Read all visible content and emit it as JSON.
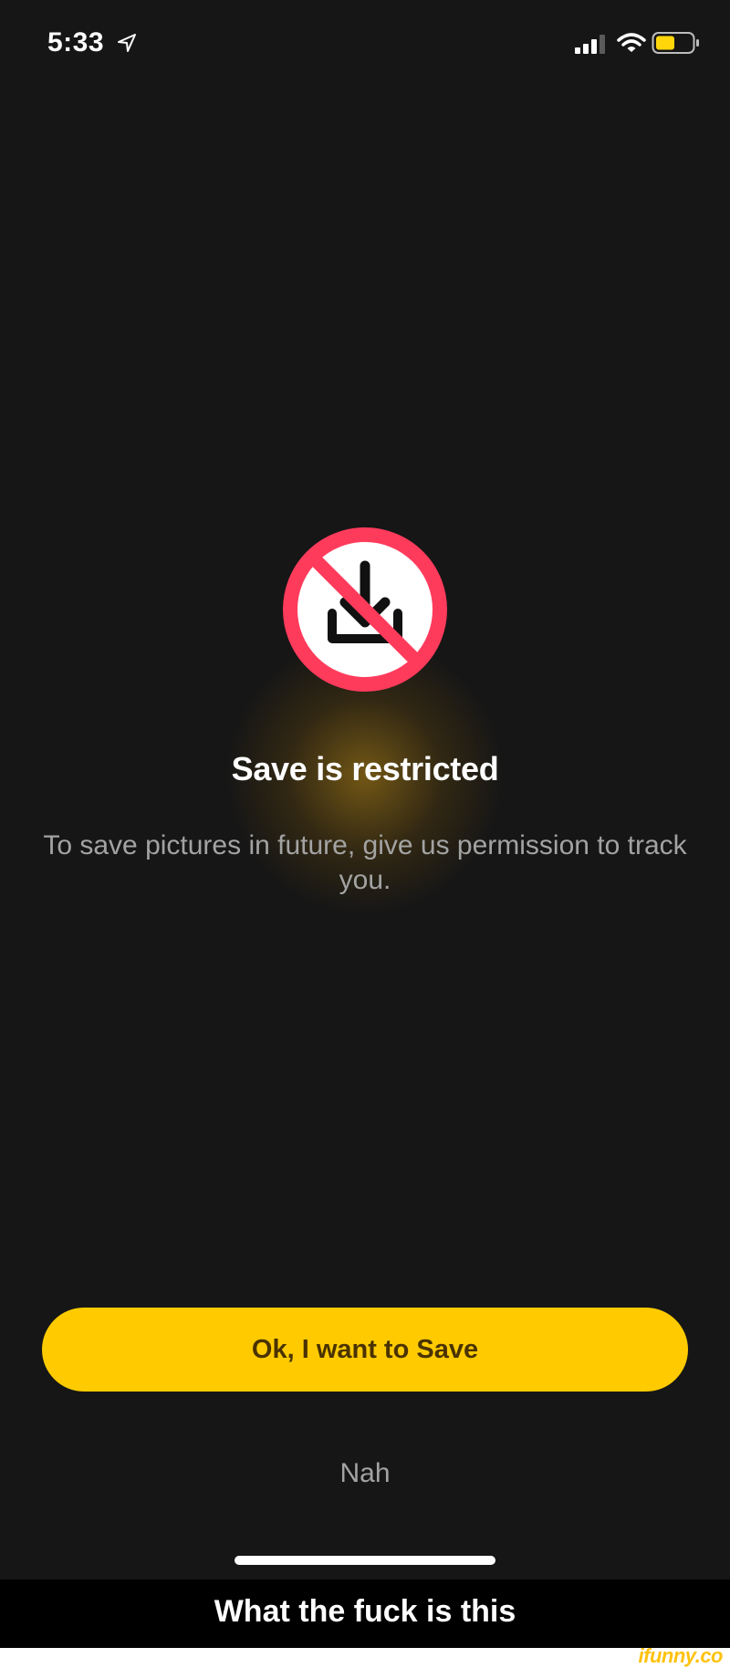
{
  "status_bar": {
    "time": "5:33",
    "location_icon": "location-arrow-icon",
    "signal_icon": "cellular-signal-icon",
    "wifi_icon": "wifi-icon",
    "battery_icon": "battery-icon",
    "battery_color": "#ffd60a"
  },
  "dialog": {
    "icon": "download-prohibited-icon",
    "icon_ring_color": "#ff3b5c",
    "title": "Save is restricted",
    "message": "To save pictures in future, give us permission to track you.",
    "primary_button": "Ok, I want to Save",
    "primary_color": "#ffcb00",
    "secondary_button": "Nah"
  },
  "caption": "What the fuck is this",
  "watermark": "ifunny.co"
}
